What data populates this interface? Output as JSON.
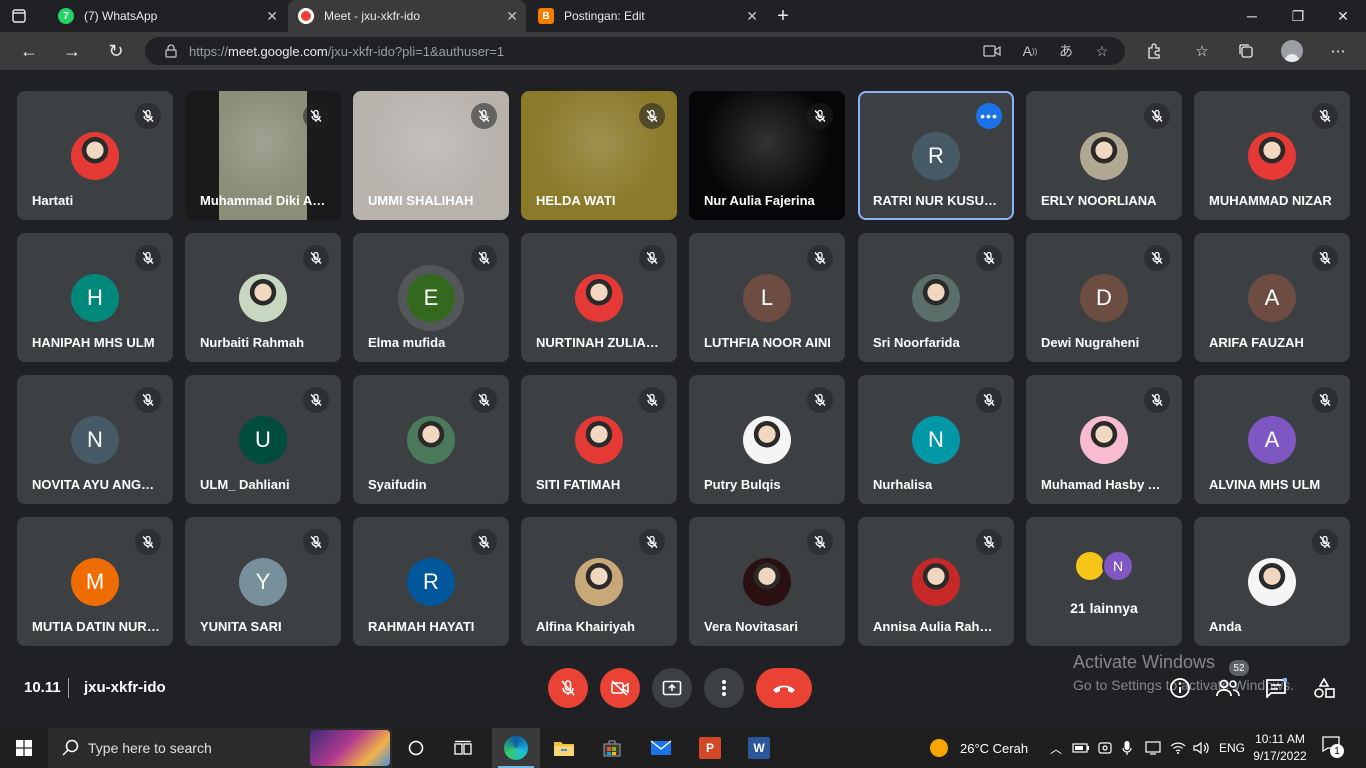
{
  "browser": {
    "tabs": [
      {
        "label": "(7) WhatsApp",
        "fav_text": "7",
        "fav_color": "#25d366"
      },
      {
        "label": "Meet - jxu-xkfr-ido",
        "fav_text": "",
        "fav_color": "#ea4335"
      },
      {
        "label": "Postingan: Edit",
        "fav_text": "B",
        "fav_color": "#f57c00"
      }
    ],
    "url_prefix": "https://",
    "url_host": "meet.google.com",
    "url_path": "/jxu-xkfr-ido?pli=1&authuser=1"
  },
  "tiles": [
    {
      "name": "Hartati",
      "kind": "photo",
      "color": "#e53935"
    },
    {
      "name": "Muhammad Diki Ariadi",
      "kind": "video",
      "color": "#8a8f7a"
    },
    {
      "name": "UMMI SHALIHAH",
      "kind": "video",
      "color": "#b8b2ad"
    },
    {
      "name": "HELDA WATI",
      "kind": "video",
      "color": "#8a7a2a"
    },
    {
      "name": "Nur Aulia Fajerina",
      "kind": "video",
      "color": "#060608"
    },
    {
      "name": "RATRI NUR KUSUMA",
      "kind": "letter",
      "letter": "R",
      "color": "#455a64",
      "selected": true
    },
    {
      "name": "ERLY NOORLIANA",
      "kind": "photo",
      "color": "#b0a890"
    },
    {
      "name": "MUHAMMAD NIZAR",
      "kind": "photo",
      "color": "#e53935"
    },
    {
      "name": "HANIPAH MHS ULM",
      "kind": "letter",
      "letter": "H",
      "color": "#00897b"
    },
    {
      "name": "Nurbaiti Rahmah",
      "kind": "photo",
      "color": "#c8d8c0"
    },
    {
      "name": "Elma mufida",
      "kind": "letter",
      "letter": "E",
      "color": "#33691e",
      "speaking": true
    },
    {
      "name": "NURTINAH ZULIANA",
      "kind": "photo",
      "color": "#e53935"
    },
    {
      "name": "LUTHFIA NOOR AINI",
      "kind": "letter",
      "letter": "L",
      "color": "#6d4c41"
    },
    {
      "name": "Sri Noorfarida",
      "kind": "photo",
      "color": "#5a6e6a"
    },
    {
      "name": "Dewi Nugraheni",
      "kind": "letter",
      "letter": "D",
      "color": "#6d4c41"
    },
    {
      "name": "ARIFA FAUZAH",
      "kind": "letter",
      "letter": "A",
      "color": "#6d4c41"
    },
    {
      "name": "NOVITA AYU ANGGRAINI",
      "kind": "letter",
      "letter": "N",
      "color": "#455a64"
    },
    {
      "name": "ULM_ Dahliani",
      "kind": "letter",
      "letter": "U",
      "color": "#004d40"
    },
    {
      "name": "Syaifudin",
      "kind": "photo",
      "color": "#4a7a5a"
    },
    {
      "name": "SITI FATIMAH",
      "kind": "photo",
      "color": "#e53935"
    },
    {
      "name": "Putry Bulqis",
      "kind": "photo",
      "color": "#f5f5f5"
    },
    {
      "name": "Nurhalisa",
      "kind": "letter",
      "letter": "N",
      "color": "#0097a7"
    },
    {
      "name": "Muhamad Hasby Assidiqi",
      "kind": "photo",
      "color": "#f8bbd0"
    },
    {
      "name": "ALVINA MHS ULM",
      "kind": "letter",
      "letter": "A",
      "color": "#7e57c2"
    },
    {
      "name": "MUTIA DATIN NURAINI",
      "kind": "letter",
      "letter": "M",
      "color": "#ef6c00"
    },
    {
      "name": "YUNITA SARI",
      "kind": "letter",
      "letter": "Y",
      "color": "#78909c"
    },
    {
      "name": "RAHMAH HAYATI",
      "kind": "letter",
      "letter": "R",
      "color": "#01579b"
    },
    {
      "name": "Alfina Khairiyah",
      "kind": "photo",
      "color": "#c8a878"
    },
    {
      "name": "Vera Novitasari",
      "kind": "photo",
      "color": "#2a1010"
    },
    {
      "name": "Annisa Aulia Rahmah",
      "kind": "photo",
      "color": "#c62828"
    },
    {
      "name": "",
      "kind": "others",
      "others_label": "21 lainnya",
      "other_letter": "N"
    },
    {
      "name": "Anda",
      "kind": "photo",
      "color": "#f5f5f5"
    }
  ],
  "meeting": {
    "time": "10.11",
    "code": "jxu-xkfr-ido",
    "participant_count": "52"
  },
  "watermark": {
    "line1": "Activate Windows",
    "line2": "Go to Settings to activate Windows."
  },
  "taskbar": {
    "search_placeholder": "Type here to search",
    "weather": "26°C  Cerah",
    "lang": "ENG",
    "time": "10:11 AM",
    "date": "9/17/2022",
    "notification_count": "1"
  }
}
